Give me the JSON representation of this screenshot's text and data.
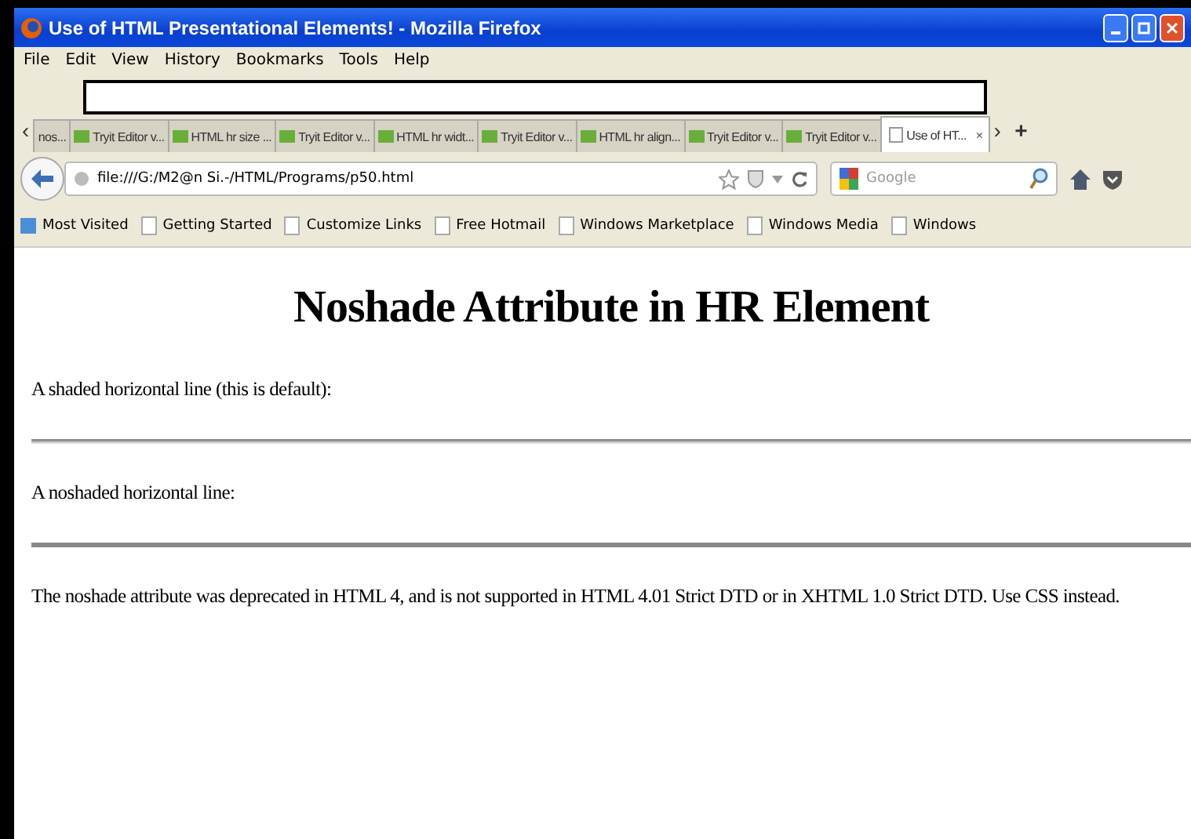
{
  "window": {
    "title": "Use of HTML Presentational Elements! - Mozilla Firefox"
  },
  "menu": [
    "File",
    "Edit",
    "View",
    "History",
    "Bookmarks",
    "Tools",
    "Help"
  ],
  "tabs": [
    {
      "label": "nos...",
      "selected": false
    },
    {
      "label": "Tryit Editor v...",
      "selected": false
    },
    {
      "label": "HTML hr size ...",
      "selected": false
    },
    {
      "label": "Tryit Editor v...",
      "selected": false
    },
    {
      "label": "HTML hr widt...",
      "selected": false
    },
    {
      "label": "Tryit Editor v...",
      "selected": false
    },
    {
      "label": "HTML hr align...",
      "selected": false
    },
    {
      "label": "Tryit Editor v...",
      "selected": false
    },
    {
      "label": "Tryit Editor v...",
      "selected": false
    },
    {
      "label": "Use of HT...",
      "selected": true
    }
  ],
  "tab_close": "×",
  "tab_scroll_left": "‹",
  "tab_scroll_right": "›",
  "new_tab": "+",
  "address": {
    "value": "file:///G:/M2@n Si.-/HTML/Programs/p50.html"
  },
  "search": {
    "placeholder": "Google"
  },
  "bookmarks": [
    "Most Visited",
    "Getting Started",
    "Customize Links",
    "Free Hotmail",
    "Windows Marketplace",
    "Windows Media",
    "Windows"
  ],
  "page": {
    "heading": "Noshade Attribute in HR Element",
    "blocks": [
      {
        "kind": "text",
        "text": "A shaded horizontal line (this is default):"
      },
      {
        "kind": "rule",
        "noshade": false
      },
      {
        "kind": "text",
        "text": "A noshaded horizontal line:"
      },
      {
        "kind": "rule",
        "noshade": true
      },
      {
        "kind": "text",
        "text": "The noshade attribute was deprecated in HTML 4, and is not supported in HTML 4.01 Strict DTD or in XHTML 1.0 Strict DTD. Use CSS instead."
      }
    ]
  }
}
